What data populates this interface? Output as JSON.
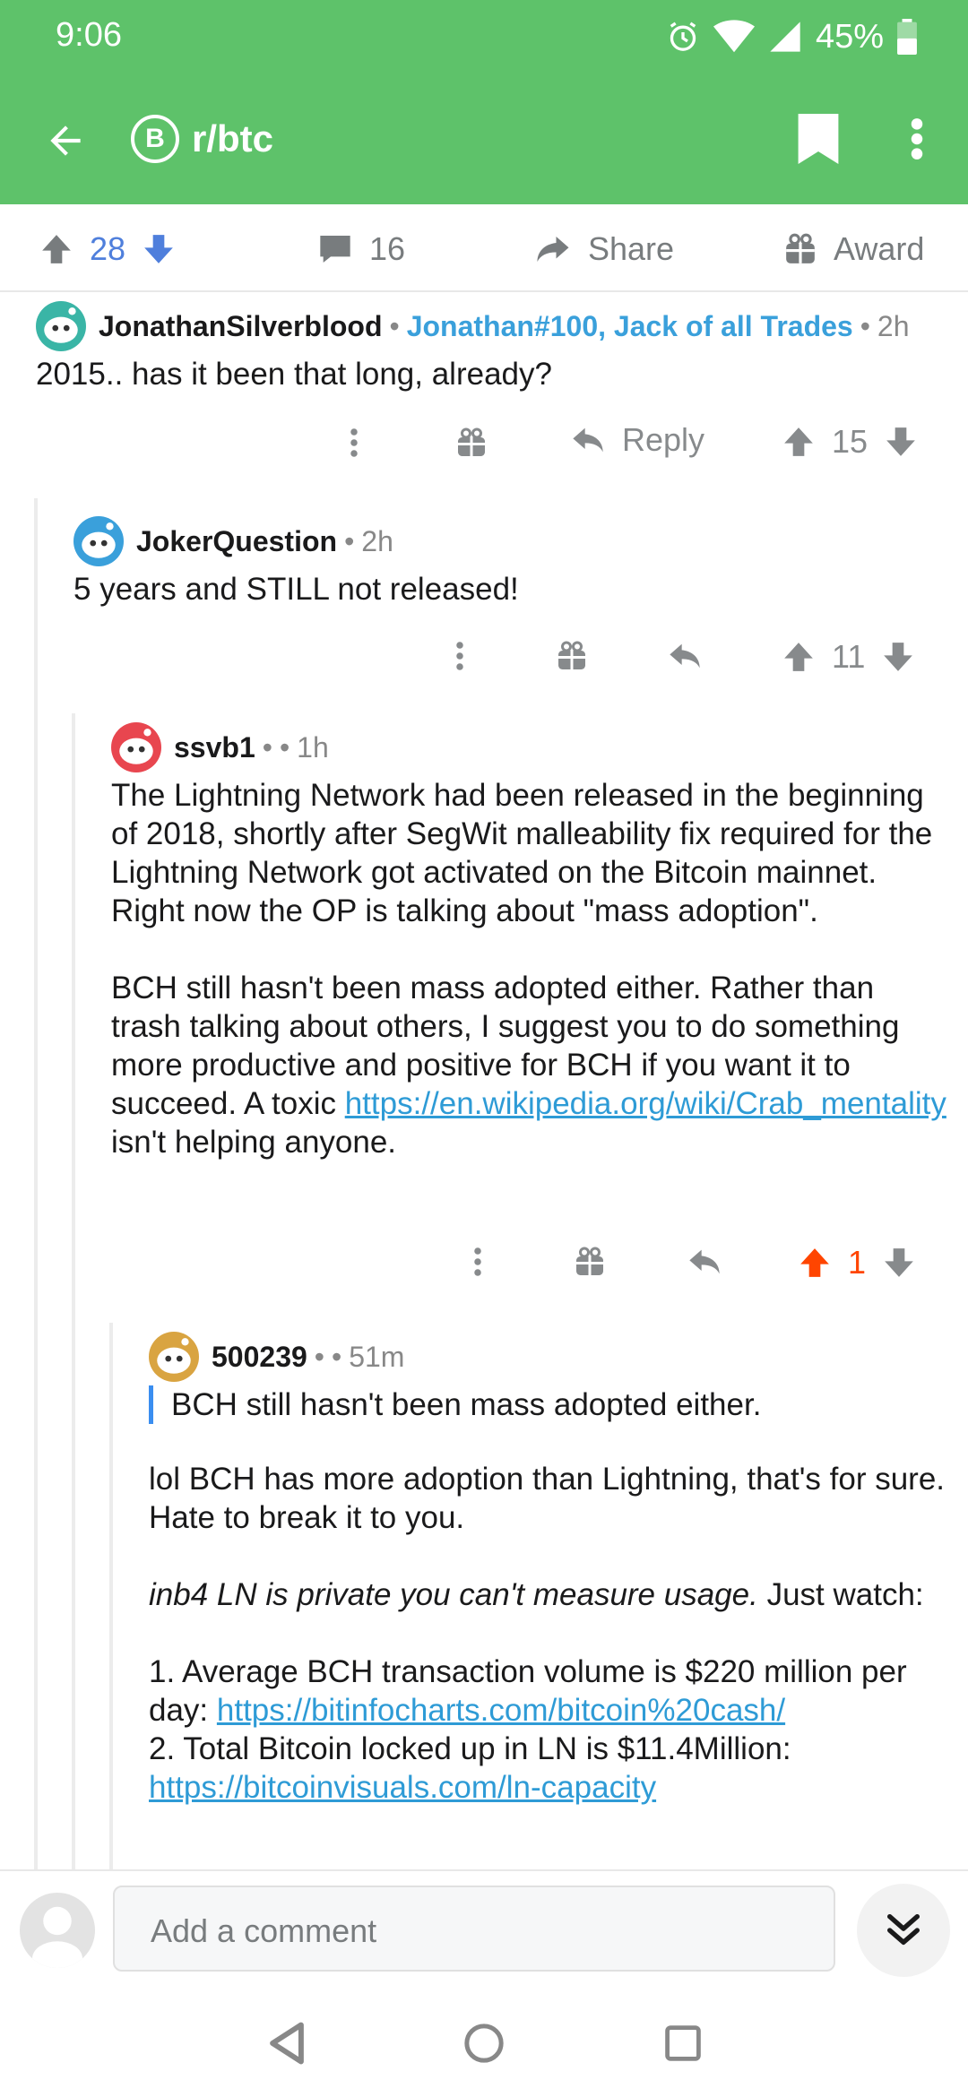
{
  "status_bar": {
    "time": "9:06",
    "battery": "45%"
  },
  "header": {
    "subreddit": "r/btc",
    "subreddit_icon_letter": "B",
    "color": "#5ec26a"
  },
  "post_actions": {
    "score": "28",
    "comments": "16",
    "share": "Share",
    "award": "Award"
  },
  "comments": [
    {
      "author": "JonathanSilverblood",
      "flair": "Jonathan#100, Jack of all Trades",
      "age": "2h",
      "body": "2015.. has it been that long, already?",
      "reply_label": "Reply",
      "score": "15"
    },
    {
      "author": "JokerQuestion",
      "age": "2h",
      "body": "5 years and STILL not released!",
      "score": "11"
    },
    {
      "author": "ssvb1",
      "sep": "•",
      "age": "1h",
      "para1": "The Lightning Network had been released in the beginning of 2018, shortly after SegWit malleability fix required for the Lightning Network got activated on the Bitcoin mainnet. Right now the OP is talking about \"mass adoption\".",
      "para2_text": "BCH still hasn't been mass adopted either. Rather than trash talking about others, I suggest you to do something more productive and positive for BCH if you want it to succeed. A toxic",
      "para2_link": "https://en.wikipedia.org/wiki/Crab_mentality",
      "para2_tail": "isn't helping anyone.",
      "score": "1",
      "score_color": "#ff4500"
    },
    {
      "author": "500239",
      "sep": "•",
      "age": "51m",
      "quote": "BCH still hasn't been mass adopted either.",
      "para1": "lol BCH has more adoption than Lightning, that's for sure. Hate to break it to you.",
      "para2_italic": "inb4 LN is private you can't measure usage.",
      "para2_tail": "Just watch:",
      "item1_text": "1. Average BCH transaction volume is $220 million per day:",
      "item1_link": "https://bitinfocharts.com/bitcoin%20cash/",
      "item2_text": "2. Total Bitcoin locked up in LN is $11.4Million:",
      "item2_link": "https://bitcoinvisuals.com/ln-capacity"
    }
  ],
  "composer": {
    "placeholder": "Add a comment"
  },
  "icons": [
    "back-arrow-icon",
    "bitcoin-icon",
    "bookmark-icon",
    "more-vert-icon",
    "upvote-icon",
    "downvote-icon",
    "comment-icon",
    "share-icon",
    "gift-icon",
    "reply-icon",
    "double-chevron-down-icon",
    "nav-back-icon",
    "nav-home-icon",
    "nav-recents-icon"
  ]
}
